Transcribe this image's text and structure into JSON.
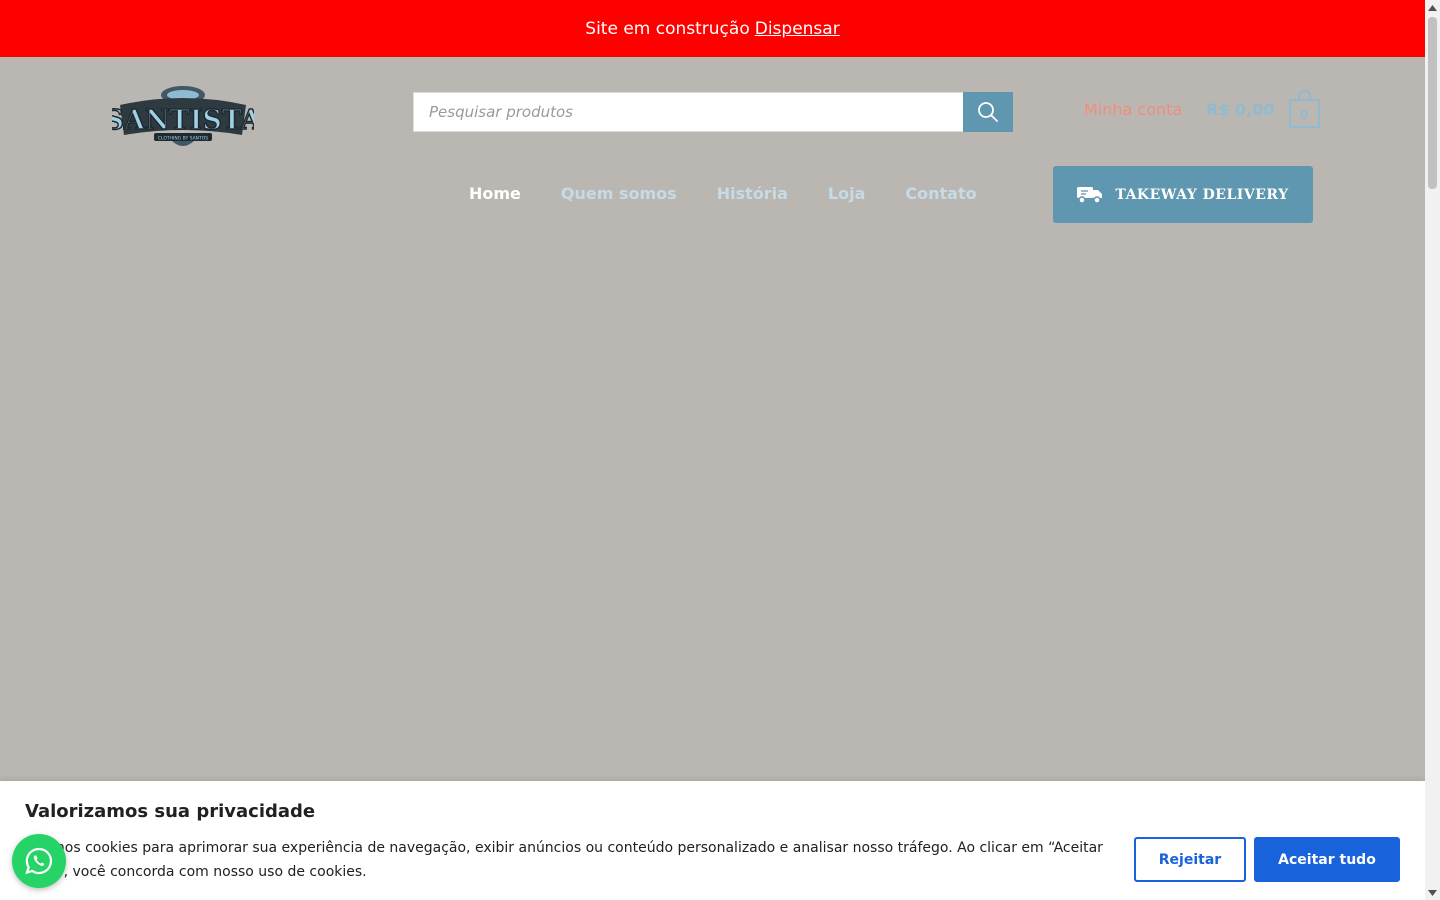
{
  "notice": {
    "text": "Site em construção",
    "dismiss_label": "Dispensar"
  },
  "header": {
    "logo_text": "SANTISTA",
    "logo_subtext": "CLOTHING BY SANTOS",
    "search": {
      "placeholder": "Pesquisar produtos",
      "value": ""
    },
    "account_label": "Minha conta",
    "cart": {
      "total": "R$ 0,00",
      "count": "0"
    }
  },
  "nav": {
    "items": [
      {
        "label": "Home",
        "active": true
      },
      {
        "label": "Quem somos",
        "active": false
      },
      {
        "label": "História",
        "active": false
      },
      {
        "label": "Loja",
        "active": false
      },
      {
        "label": "Contato",
        "active": false
      }
    ]
  },
  "delivery_button": {
    "label": "TAKEWAY DELIVERY",
    "icon": "delivery-truck-icon"
  },
  "cookie": {
    "title": "Valorizamos sua privacidade",
    "text": "Usamos cookies para aprimorar sua experiência de navegação, exibir anúncios ou conteúdo personalizado e analisar nosso tráfego. Ao clicar em “Aceitar tudo”, você concorda com nosso uso de cookies.",
    "reject_label": "Rejeitar",
    "accept_label": "Aceitar tudo"
  },
  "colors": {
    "notice_bg": "#ff0000",
    "page_bg": "#bab7b2",
    "accent_blue": "#5f97b0",
    "account_link": "#f08d7d",
    "cookie_button": "#1863dc",
    "whatsapp": "#25d366"
  }
}
